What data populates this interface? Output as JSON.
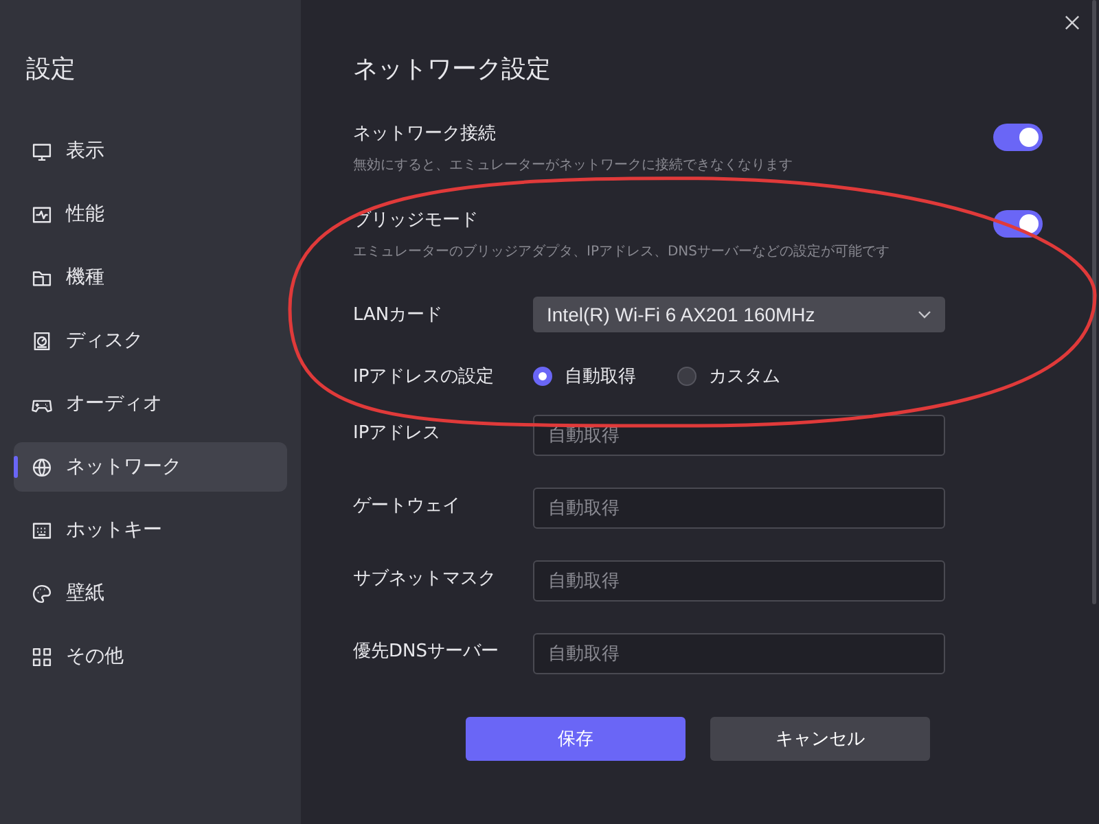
{
  "sidebar": {
    "title": "設定",
    "items": [
      {
        "label": "表示",
        "selected": false
      },
      {
        "label": "性能",
        "selected": false
      },
      {
        "label": "機種",
        "selected": false
      },
      {
        "label": "ディスク",
        "selected": false
      },
      {
        "label": "オーディオ",
        "selected": false
      },
      {
        "label": "ネットワーク",
        "selected": true
      },
      {
        "label": "ホットキー",
        "selected": false
      },
      {
        "label": "壁紙",
        "selected": false
      },
      {
        "label": "その他",
        "selected": false
      }
    ]
  },
  "main": {
    "title": "ネットワーク設定",
    "toggles": [
      {
        "label": "ネットワーク接続",
        "description": "無効にすると、エミュレーターがネットワークに接続できなくなります",
        "on": true
      },
      {
        "label": "ブリッジモード",
        "description": "エミュレーターのブリッジアダプタ、IPアドレス、DNSサーバーなどの設定が可能です",
        "on": true
      }
    ],
    "lan_card": {
      "label": "LANカード",
      "value": "Intel(R) Wi-Fi 6 AX201 160MHz"
    },
    "ip_setting": {
      "label": "IPアドレスの設定",
      "options": [
        {
          "label": "自動取得",
          "selected": true
        },
        {
          "label": "カスタム",
          "selected": false
        }
      ]
    },
    "fields": [
      {
        "label": "IPアドレス",
        "placeholder": "自動取得"
      },
      {
        "label": "ゲートウェイ",
        "placeholder": "自動取得"
      },
      {
        "label": "サブネットマスク",
        "placeholder": "自動取得"
      },
      {
        "label": "優先DNSサーバー",
        "placeholder": "自動取得"
      }
    ],
    "buttons": [
      {
        "label": "保存",
        "kind": "primary"
      },
      {
        "label": "キャンセル",
        "kind": "secondary"
      }
    ]
  }
}
